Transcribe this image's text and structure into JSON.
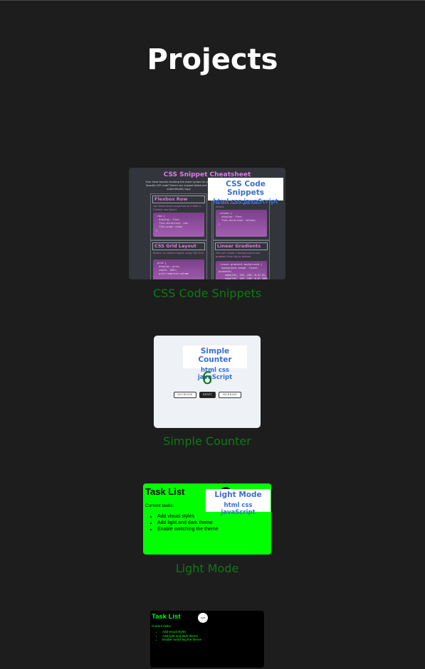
{
  "page": {
    "title": "Projects"
  },
  "projects": [
    {
      "caption": "CSS Code Snippets",
      "badge": {
        "title": "CSS Code Snippets",
        "tags": "html css javaScript"
      },
      "preview": {
        "heading": "CSS Snippet Cheatsheet",
        "description": "Ever have trouble recalling the exact syntax for your favorite CSS code? Select any snippet below and it'll automatically copy",
        "panels": [
          {
            "title": "Flexbox Row",
            "text": "Use these three properties to create a Flexbox row layout.",
            "code": ".row {\n  display: flex;\n  flex-direction: row;\n  flex-wrap: wrap;\n}"
          },
          {
            "title": "",
            "text": "Use this to create a Flexbox column layout.",
            "code": ".column {\n  display: flex;\n  flex-direction: column;\n}"
          },
          {
            "title": "CSS Grid Layout",
            "text": "Build a 12-column layout using CSS Grid",
            "code": ".grid {\n  display: grid;\n  width: 100%;\n  grid-template-column"
          },
          {
            "title": "Linear Gradients",
            "text": "This will create a background linear gradient from top to bottom.",
            "code": ".linear-gradient-background {\n  background-image: linear-\ngradient(\n    rgba(232, 102, 236, 0.3) 0%,\n    rgba(232, 102, 236, 0.6) 100%"
          }
        ]
      }
    },
    {
      "caption": "Simple Counter",
      "badge": {
        "title": "Simple Counter",
        "tags": "html css javaScript"
      },
      "preview": {
        "count": "6",
        "decrease": "DECREASE",
        "reset": "RESET",
        "increase": "INCREASE"
      }
    },
    {
      "caption": "Light Mode",
      "badge": {
        "title": "Light Mode",
        "tags": "html css javaScript"
      },
      "preview": {
        "heading": "Task List",
        "subheading": "Current tasks:",
        "tasks": [
          "Add visual styles",
          "Add light and dark theme",
          "Enable switching the theme"
        ],
        "toggle": "Dark"
      }
    },
    {
      "caption": "",
      "preview": {
        "heading": "Task List",
        "subheading": "Current tasks:",
        "tasks": [
          "Add visual styles",
          "Add light and dark theme",
          "Enable switching the theme"
        ],
        "toggle": "Light"
      }
    }
  ],
  "colors": {
    "background": "#1d1d1d",
    "title": "#ffffff",
    "caption": "#0d7a14",
    "badge_text": "#3a6fd0",
    "task_green": "#00ff00",
    "cheatsheet_pink": "#e07ae6"
  }
}
